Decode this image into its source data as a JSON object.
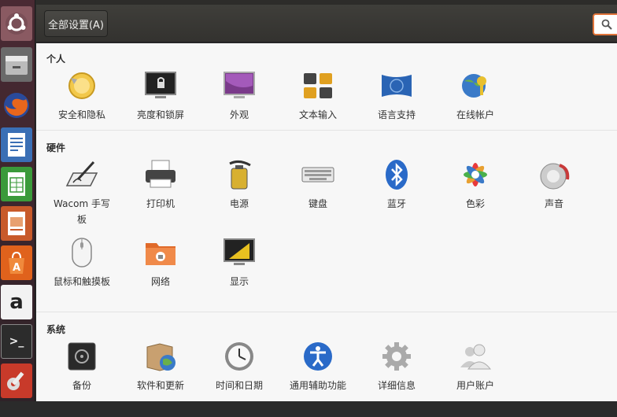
{
  "header": {
    "all_settings_label": "全部设置(A)"
  },
  "sections": [
    {
      "title": "个人",
      "items": [
        {
          "label": "安全和隐私",
          "icon": "shield-lock-icon"
        },
        {
          "label": "亮度和锁屏",
          "icon": "monitor-lock-icon"
        },
        {
          "label": "外观",
          "icon": "appearance-monitor-icon"
        },
        {
          "label": "文本输入",
          "icon": "keyboard-layout-icon"
        },
        {
          "label": "语言支持",
          "icon": "language-flag-icon"
        },
        {
          "label": "在线帐户",
          "icon": "online-accounts-icon"
        }
      ]
    },
    {
      "title": "硬件",
      "items": [
        {
          "label": "Wacom 手写板",
          "icon": "tablet-pen-icon"
        },
        {
          "label": "打印机",
          "icon": "printer-icon"
        },
        {
          "label": "电源",
          "icon": "battery-power-icon"
        },
        {
          "label": "键盘",
          "icon": "keyboard-icon"
        },
        {
          "label": "蓝牙",
          "icon": "bluetooth-icon"
        },
        {
          "label": "色彩",
          "icon": "color-flower-icon"
        },
        {
          "label": "声音",
          "icon": "speaker-icon"
        },
        {
          "label": "鼠标和触摸板",
          "icon": "mouse-icon"
        },
        {
          "label": "网络",
          "icon": "network-folder-icon"
        },
        {
          "label": "显示",
          "icon": "display-icon"
        }
      ]
    },
    {
      "title": "系统",
      "items": [
        {
          "label": "备份",
          "icon": "backup-safe-icon"
        },
        {
          "label": "软件和更新",
          "icon": "software-box-icon"
        },
        {
          "label": "时间和日期",
          "icon": "clock-icon"
        },
        {
          "label": "通用辅助功能",
          "icon": "accessibility-icon"
        },
        {
          "label": "详细信息",
          "icon": "gear-icon"
        },
        {
          "label": "用户账户",
          "icon": "users-icon"
        }
      ]
    }
  ],
  "launcher": [
    {
      "icon": "ubuntu-dash-icon"
    },
    {
      "icon": "files-icon"
    },
    {
      "icon": "firefox-icon"
    },
    {
      "icon": "writer-icon"
    },
    {
      "icon": "calc-icon"
    },
    {
      "icon": "impress-icon"
    },
    {
      "icon": "software-center-icon"
    },
    {
      "icon": "amazon-icon",
      "glyph": "a"
    },
    {
      "icon": "terminal-icon",
      "glyph": ">_"
    },
    {
      "icon": "system-settings-icon"
    }
  ]
}
